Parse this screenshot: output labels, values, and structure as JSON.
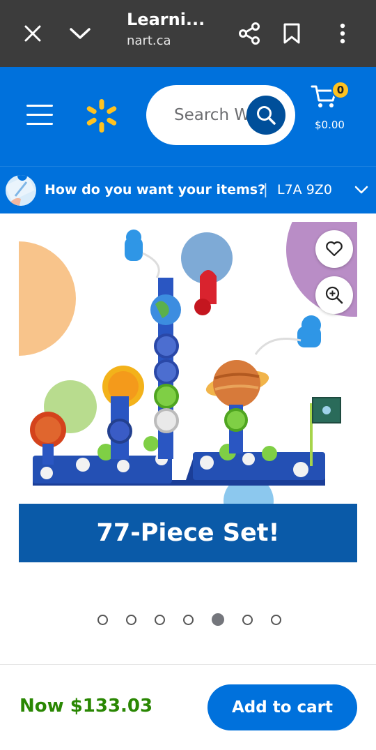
{
  "browser": {
    "title": "Learni...",
    "url": "nart.ca",
    "icons": [
      "close-icon",
      "chevron-down-icon",
      "share-icon",
      "bookmark-icon",
      "more-vert-icon"
    ]
  },
  "header": {
    "search_placeholder": "Search W",
    "cart_count": "0",
    "cart_total": "$0.00",
    "brand_color": "#0071dc",
    "spark_color": "#ffc220"
  },
  "delivery": {
    "question": "How do you want your items?",
    "separator": "|",
    "postal_code": "L7A 9Z0"
  },
  "product": {
    "banner": "77-Piece Set!",
    "carousel": {
      "total": 7,
      "active_index": 4
    }
  },
  "purchase": {
    "price": "Now $133.03",
    "add_to_cart": "Add to cart",
    "price_color": "#2a8703"
  }
}
